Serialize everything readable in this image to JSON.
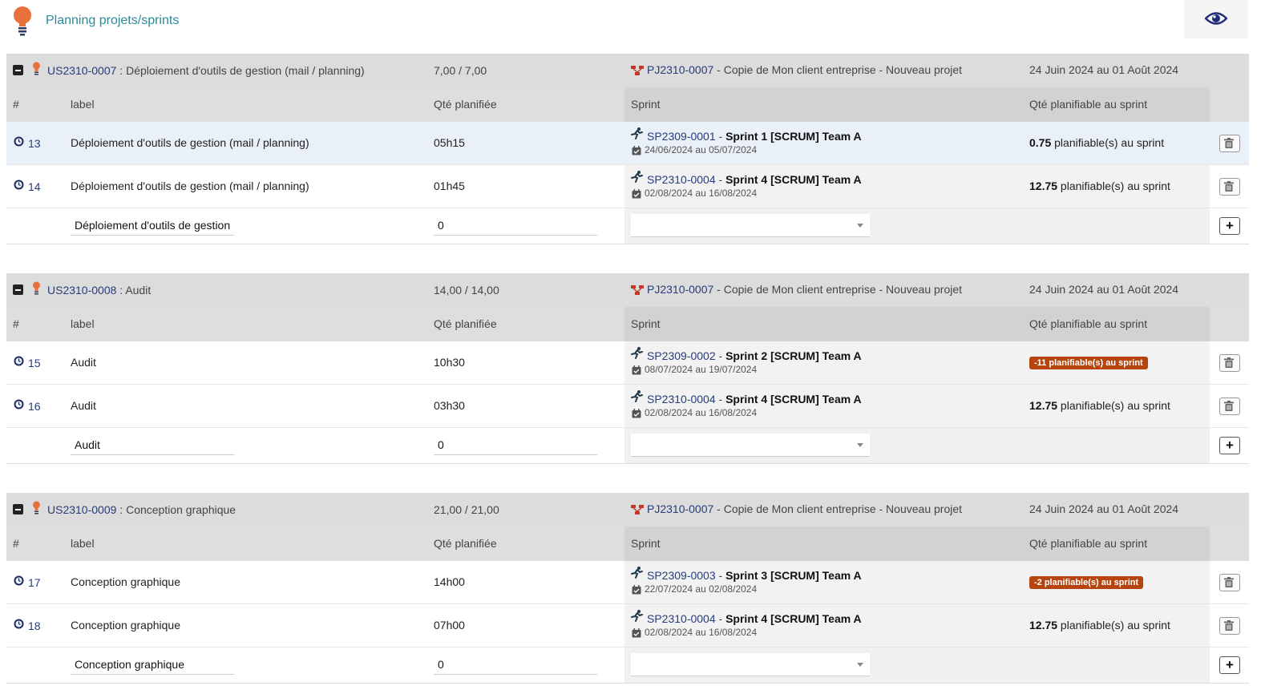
{
  "page": {
    "title": "Planning projets/sprints"
  },
  "columns": {
    "num": "#",
    "label": "label",
    "qty": "Qté planifiée",
    "sprint": "Sprint",
    "sprint_qty": "Qté planifiable au sprint"
  },
  "groups": [
    {
      "ref": "US2310-0007",
      "sep": " : ",
      "title": "Déploiement d'outils de gestion (mail / planning)",
      "qty": "7,00 / 7,00",
      "project_ref": "PJ2310-0007",
      "project_label": " - Copie de Mon client entreprise - Nouveau projet",
      "dates": "24 Juin 2024 au 01 Août 2024",
      "lines": [
        {
          "num": "13",
          "label": "Déploiement d'outils de gestion (mail / planning)",
          "qty": "05h15",
          "sprint_ref": "SP2309-0001",
          "sprint_sep": " - ",
          "sprint_name": "Sprint 1 [SCRUM] Team A",
          "sprint_dates": "24/06/2024 au 05/07/2024",
          "avail_value": "0.75",
          "avail_text": " planifiable(s) au sprint",
          "avail_badge": ""
        },
        {
          "num": "14",
          "label": "Déploiement d'outils de gestion (mail / planning)",
          "qty": "01h45",
          "sprint_ref": "SP2310-0004",
          "sprint_sep": " - ",
          "sprint_name": "Sprint 4 [SCRUM] Team A",
          "sprint_dates": "02/08/2024 au 16/08/2024",
          "avail_value": "12.75",
          "avail_text": " planifiable(s) au sprint",
          "avail_badge": ""
        }
      ],
      "add": {
        "label_value": "Déploiement d'outils de gestion (mail / planning)",
        "qty_value": "0"
      }
    },
    {
      "ref": "US2310-0008",
      "sep": " : ",
      "title": "Audit",
      "qty": "14,00 / 14,00",
      "project_ref": "PJ2310-0007",
      "project_label": " - Copie de Mon client entreprise - Nouveau projet",
      "dates": "24 Juin 2024 au 01 Août 2024",
      "lines": [
        {
          "num": "15",
          "label": "Audit",
          "qty": "10h30",
          "sprint_ref": "SP2309-0002",
          "sprint_sep": " - ",
          "sprint_name": "Sprint 2 [SCRUM] Team A",
          "sprint_dates": "08/07/2024 au 19/07/2024",
          "avail_value": "",
          "avail_text": "",
          "avail_badge": "-11 planifiable(s) au sprint"
        },
        {
          "num": "16",
          "label": "Audit",
          "qty": "03h30",
          "sprint_ref": "SP2310-0004",
          "sprint_sep": " - ",
          "sprint_name": "Sprint 4 [SCRUM] Team A",
          "sprint_dates": "02/08/2024 au 16/08/2024",
          "avail_value": "12.75",
          "avail_text": " planifiable(s) au sprint",
          "avail_badge": ""
        }
      ],
      "add": {
        "label_value": "Audit",
        "qty_value": "0"
      }
    },
    {
      "ref": "US2310-0009",
      "sep": " : ",
      "title": "Conception graphique",
      "qty": "21,00 / 21,00",
      "project_ref": "PJ2310-0007",
      "project_label": " - Copie de Mon client entreprise - Nouveau projet",
      "dates": "24 Juin 2024 au 01 Août 2024",
      "lines": [
        {
          "num": "17",
          "label": "Conception graphique",
          "qty": "14h00",
          "sprint_ref": "SP2309-0003",
          "sprint_sep": " - ",
          "sprint_name": "Sprint 3 [SCRUM] Team A",
          "sprint_dates": "22/07/2024 au 02/08/2024",
          "avail_value": "",
          "avail_text": "",
          "avail_badge": "-2 planifiable(s) au sprint"
        },
        {
          "num": "18",
          "label": "Conception graphique",
          "qty": "07h00",
          "sprint_ref": "SP2310-0004",
          "sprint_sep": " - ",
          "sprint_name": "Sprint 4 [SCRUM] Team A",
          "sprint_dates": "02/08/2024 au 16/08/2024",
          "avail_value": "12.75",
          "avail_text": " planifiable(s) au sprint",
          "avail_badge": ""
        }
      ],
      "add": {
        "label_value": "Conception graphique",
        "qty_value": "0"
      }
    }
  ],
  "icons": {
    "page": "lightbulb-icon",
    "toggle": "eye-icon",
    "collapse": "minus-square-icon",
    "userstory": "lightbulb-icon",
    "project": "project-tree-icon",
    "task": "clock-icon",
    "sprint": "running-person-icon",
    "calendar": "calendar-check-icon",
    "delete": "trash-icon",
    "add": "plus-icon"
  },
  "colors": {
    "accent": "#2a8a9a",
    "link": "#263c7c",
    "badge": "#b5440f",
    "bulb": "#e8703a"
  }
}
